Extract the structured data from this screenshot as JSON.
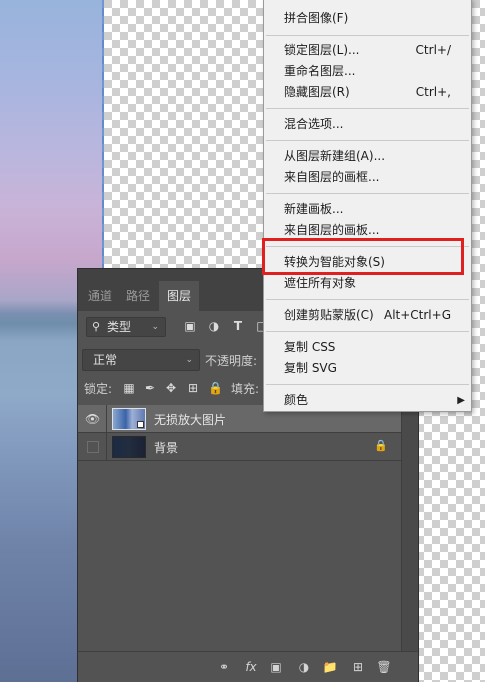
{
  "panel": {
    "tabs": [
      "通道",
      "路径",
      "图层"
    ],
    "active_tab": "图层",
    "filter": {
      "kind_label": "类型"
    },
    "blend_mode": "正常",
    "opacity_label": "不透明度:",
    "lock_label": "锁定:",
    "fill_label": "填充:",
    "layers": [
      {
        "name": "无损放大图片",
        "visible": true,
        "selected": true,
        "type": "smart-object"
      },
      {
        "name": "背景",
        "visible": false,
        "selected": false,
        "type": "background",
        "locked": true
      }
    ]
  },
  "menu": {
    "items": [
      {
        "label": "拼合图像(F)",
        "shortcut": ""
      },
      {
        "label": "锁定图层(L)...",
        "shortcut": "Ctrl+/"
      },
      {
        "label": "重命名图层...",
        "shortcut": ""
      },
      {
        "label": "隐藏图层(R)",
        "shortcut": "Ctrl+,"
      },
      {
        "label": "混合选项...",
        "shortcut": ""
      },
      {
        "label": "从图层新建组(A)...",
        "shortcut": ""
      },
      {
        "label": "来自图层的画框...",
        "shortcut": ""
      },
      {
        "label": "新建画板...",
        "shortcut": ""
      },
      {
        "label": "来自图层的画板...",
        "shortcut": ""
      },
      {
        "label": "转换为智能对象(S)",
        "shortcut": ""
      },
      {
        "label": "遮住所有对象",
        "shortcut": ""
      },
      {
        "label": "创建剪贴蒙版(C)",
        "shortcut": "Alt+Ctrl+G"
      },
      {
        "label": "复制 CSS",
        "shortcut": ""
      },
      {
        "label": "复制 SVG",
        "shortcut": ""
      },
      {
        "label": "颜色",
        "shortcut": ""
      }
    ],
    "highlighted_item": "转换为智能对象(S)",
    "highlight_color": "#e0201e"
  }
}
